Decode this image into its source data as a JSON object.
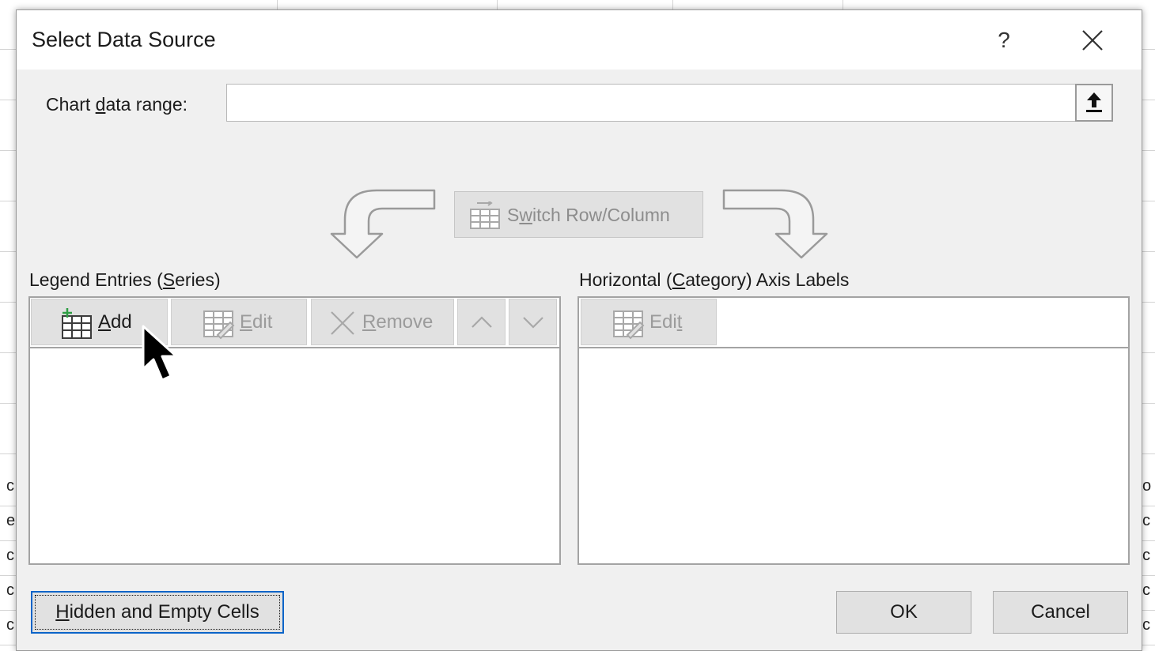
{
  "dialog": {
    "title": "Select Data Source",
    "help_label": "?"
  },
  "range": {
    "label_before": "Chart ",
    "label_accel": "d",
    "label_after": "ata range:",
    "value": ""
  },
  "switch_button": {
    "label_before": "S",
    "label_accel": "w",
    "label_after": "itch Row/Column"
  },
  "legend_panel": {
    "heading_before": "Legend Entries (",
    "heading_accel": "S",
    "heading_after": "eries)",
    "add": {
      "accel": "A",
      "rest": "dd"
    },
    "edit": {
      "accel": "E",
      "rest": "dit"
    },
    "remove": {
      "accel": "R",
      "rest": "emove"
    },
    "items": []
  },
  "axis_panel": {
    "heading_before": "Horizontal (",
    "heading_accel": "C",
    "heading_after": "ategory) Axis Labels",
    "edit": {
      "before": "Edi",
      "accel": "t"
    },
    "items": []
  },
  "footer": {
    "hidden_accel": "H",
    "hidden_rest": "idden and Empty Cells",
    "ok": "OK",
    "cancel": "Cancel"
  },
  "background_fragments": {
    "left": [
      "c",
      "e",
      "c",
      "c",
      "c"
    ],
    "right": [
      "o",
      "c",
      "c",
      "c",
      "c"
    ]
  },
  "colors": {
    "dialog_bg": "#f0f0f0",
    "button_bg": "#e1e1e1",
    "focus_border": "#0a64c8",
    "disabled_text": "#9b9b9b"
  }
}
